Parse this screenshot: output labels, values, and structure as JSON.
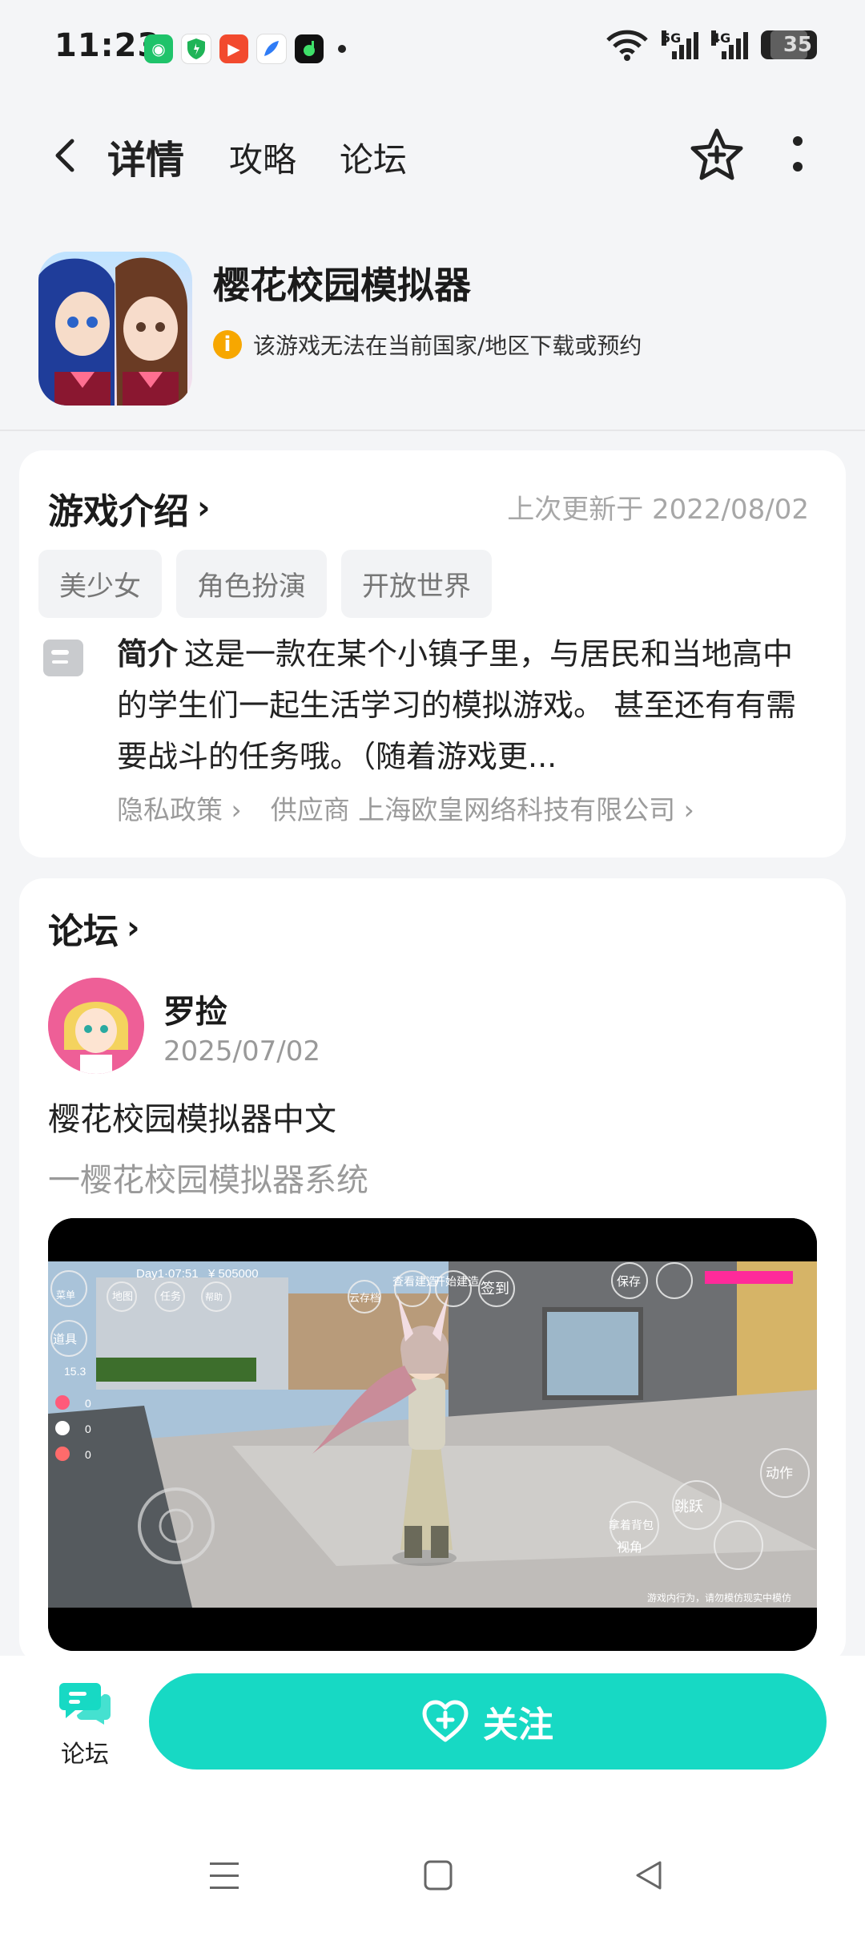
{
  "status_bar": {
    "time": "11:23",
    "signal1_label": "5G",
    "signal2_label": "4G",
    "battery": "35"
  },
  "nav": {
    "tabs": [
      {
        "label": "详情",
        "active": true
      },
      {
        "label": "攻略",
        "active": false
      },
      {
        "label": "论坛",
        "active": false
      }
    ]
  },
  "game": {
    "title": "樱花校园模拟器",
    "warning": "该游戏无法在当前国家/地区下载或预约"
  },
  "intro": {
    "heading": "游戏介绍",
    "last_update": "上次更新于 2022/08/02",
    "tags": [
      "美少女",
      "角色扮演",
      "开放世界"
    ],
    "desc_label": "简介",
    "desc_text": "这是一款在某个小镇子里，与居民和当地高中的学生们一起生活学习的模拟游戏。 甚至还有有需要战斗的任务哦。（随着游戏更...",
    "privacy": "隐私政策",
    "supplier": "供应商 上海欧皇网络科技有限公司"
  },
  "forum": {
    "heading": "论坛",
    "post": {
      "author": "罗捡",
      "date": "2025/07/02",
      "title": "樱花校园模拟器中文",
      "subtitle": "一樱花校园模拟器系统"
    },
    "video_hud": {
      "day": "Day1·07:51",
      "money": "¥ 505000",
      "buttons": [
        "菜单",
        "地图",
        "任务",
        "帮助",
        "云存档",
        "查看建造",
        "开始建造",
        "签到",
        "保存",
        "道具",
        "动作",
        "拿着背包",
        "视角",
        "跳跃"
      ],
      "stat": "15.3",
      "counters": [
        "0",
        "0",
        "0"
      ],
      "notice": "游戏内行为，请勿模仿现实中模仿"
    }
  },
  "bottom": {
    "forum_label": "论坛",
    "follow_label": "关注"
  },
  "colors": {
    "accent": "#17d9c4",
    "warning": "#f7a700"
  }
}
